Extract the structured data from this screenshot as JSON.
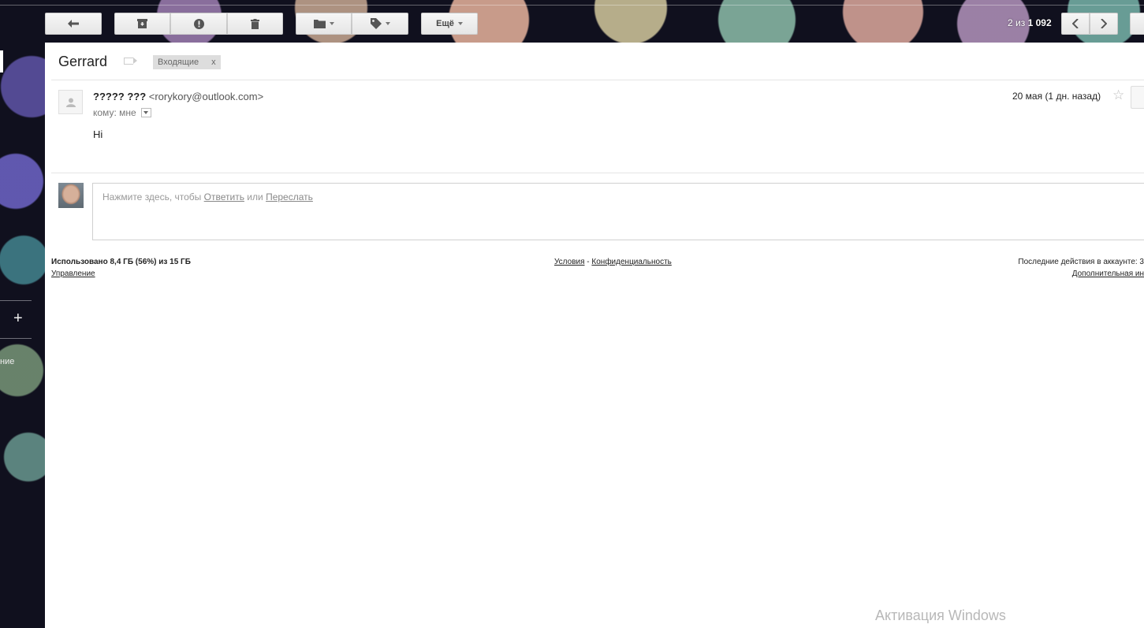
{
  "toolbar": {
    "more_label": "Ещё",
    "pager": {
      "current": "2",
      "sep": "из",
      "total": "1 092"
    }
  },
  "sidebar": {
    "partial_label": "ние"
  },
  "message": {
    "subject": "Gerrard",
    "label_chip": "Входящие",
    "label_remove": "x",
    "sender_name": "????? ???",
    "sender_email": "<rorykory@outlook.com>",
    "recipient": "кому: мне",
    "date": "20 мая (1 дн. назад)",
    "body": "Hi"
  },
  "reply": {
    "prefix": "Нажмите здесь, чтобы",
    "reply_link": "Ответить",
    "or": "или",
    "forward_link": "Переслать"
  },
  "footer": {
    "storage": "Использовано 8,4 ГБ (56%) из 15 ГБ",
    "manage": "Управление",
    "terms": "Условия",
    "dash": "-",
    "privacy": "Конфиденциальность",
    "activity": "Последние действия в аккаунте: 3",
    "details": "Дополнительная ин"
  },
  "watermark": "Активация Windows"
}
